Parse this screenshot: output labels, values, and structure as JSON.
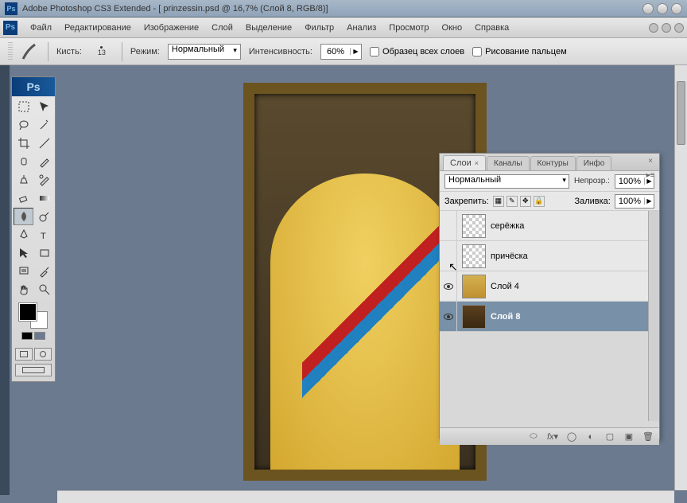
{
  "titlebar": {
    "app_name": "Adobe Photoshop CS3 Extended",
    "document": "prinzessin.psd",
    "zoom": "16,7%",
    "layer_info": "Слой 8, RGB/8",
    "full_title": "Adobe Photoshop CS3 Extended - [ prinzessin.psd @ 16,7% (Слой 8, RGB/8)]"
  },
  "menu": {
    "items": [
      "Файл",
      "Редактирование",
      "Изображение",
      "Слой",
      "Выделение",
      "Фильтр",
      "Анализ",
      "Просмотр",
      "Окно",
      "Справка"
    ]
  },
  "options": {
    "brush_label": "Кисть:",
    "brush_size": "13",
    "mode_label": "Режим:",
    "mode_value": "Нормальный",
    "intensity_label": "Интенсивность:",
    "intensity_value": "60%",
    "sample_all_label": "Образец всех слоев",
    "sample_all_checked": false,
    "finger_paint_label": "Рисование пальцем",
    "finger_paint_checked": false
  },
  "toolbox": {
    "logo": "Ps",
    "foreground": "#000000",
    "background": "#ffffff",
    "active_tool": "smudge"
  },
  "panel": {
    "tabs": [
      "Слои",
      "Каналы",
      "Контуры",
      "Инфо"
    ],
    "active_tab": 0,
    "blend_mode": "Нормальный",
    "opacity_label": "Непрозр.:",
    "opacity_value": "100%",
    "lock_label": "Закрепить:",
    "fill_label": "Заливка:",
    "fill_value": "100%",
    "layers": [
      {
        "name": "серёжка",
        "visible": false,
        "thumb": "checker",
        "selected": false
      },
      {
        "name": "причёска",
        "visible": false,
        "thumb": "checker",
        "selected": false
      },
      {
        "name": "Слой 4",
        "visible": true,
        "thumb": "img1",
        "selected": false
      },
      {
        "name": "Слой 8",
        "visible": true,
        "thumb": "img2",
        "selected": true
      }
    ]
  },
  "chart_data": null
}
